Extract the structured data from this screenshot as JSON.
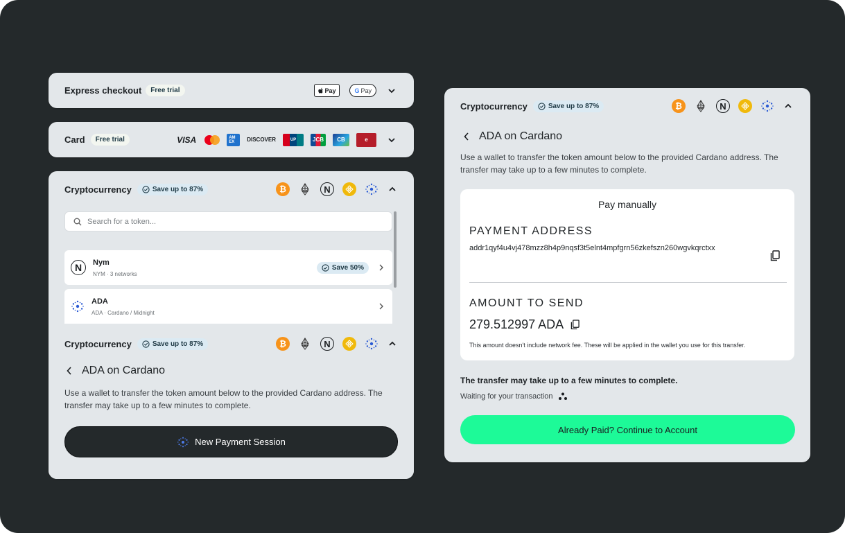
{
  "express": {
    "title": "Express checkout",
    "badge": "Free trial",
    "applepay": "Pay",
    "gpay": "Pay"
  },
  "card": {
    "title": "Card",
    "badge": "Free trial",
    "brands": [
      "VISA",
      "DISCOVER",
      "JCB"
    ]
  },
  "crypto_top": {
    "title": "Cryptocurrency",
    "badge": "Save up to 87%",
    "search_placeholder": "Search for a token...",
    "tokens": [
      {
        "name": "Nym",
        "sub": "NYM · 3 networks",
        "badge": "Save 50%"
      },
      {
        "name": "ADA",
        "sub": "ADA · Cardano / Midnight"
      }
    ]
  },
  "crypto_bottom": {
    "title": "Cryptocurrency",
    "badge": "Save up to 87%",
    "heading": "ADA on Cardano",
    "description": "Use a wallet to transfer the token amount below to the provided Cardano address. The transfer may take up to a few minutes to complete.",
    "button": "New Payment Session"
  },
  "right": {
    "title": "Cryptocurrency",
    "badge": "Save up to 87%",
    "heading": "ADA on Cardano",
    "description": "Use a wallet to transfer the token amount below to the provided Cardano address. The transfer may take up to a few minutes to complete.",
    "box_title": "Pay manually",
    "address_label": "PAYMENT ADDRESS",
    "address": "addr1qyf4u4vj478mzz8h4p9nqsf3t5elnt4mpfgrn56zkefszn260wgvkqrctxx",
    "amount_label": "AMOUNT TO SEND",
    "amount": "279.512997 ADA",
    "fee_note": "This amount doesn't include network fee. These will be applied in the wallet you use for this transfer.",
    "status_title": "The transfer may take up to a few minutes to complete.",
    "status_text": "Waiting for your transaction",
    "button": "Already Paid? Continue to Account"
  },
  "colors": {
    "background": "#24292b",
    "panel": "#e3e7ea",
    "accent_green": "#1dfa98",
    "bitcoin": "#f7931a",
    "bnb": "#f0b90b"
  },
  "icons": [
    "chevron-down-icon",
    "chevron-up-icon",
    "chevron-left-icon",
    "chevron-right-icon",
    "search-icon",
    "copy-icon",
    "check-badge-icon",
    "bitcoin-icon",
    "ethereum-icon",
    "nym-icon",
    "bnb-icon",
    "cardano-icon",
    "loading-dots-icon"
  ]
}
